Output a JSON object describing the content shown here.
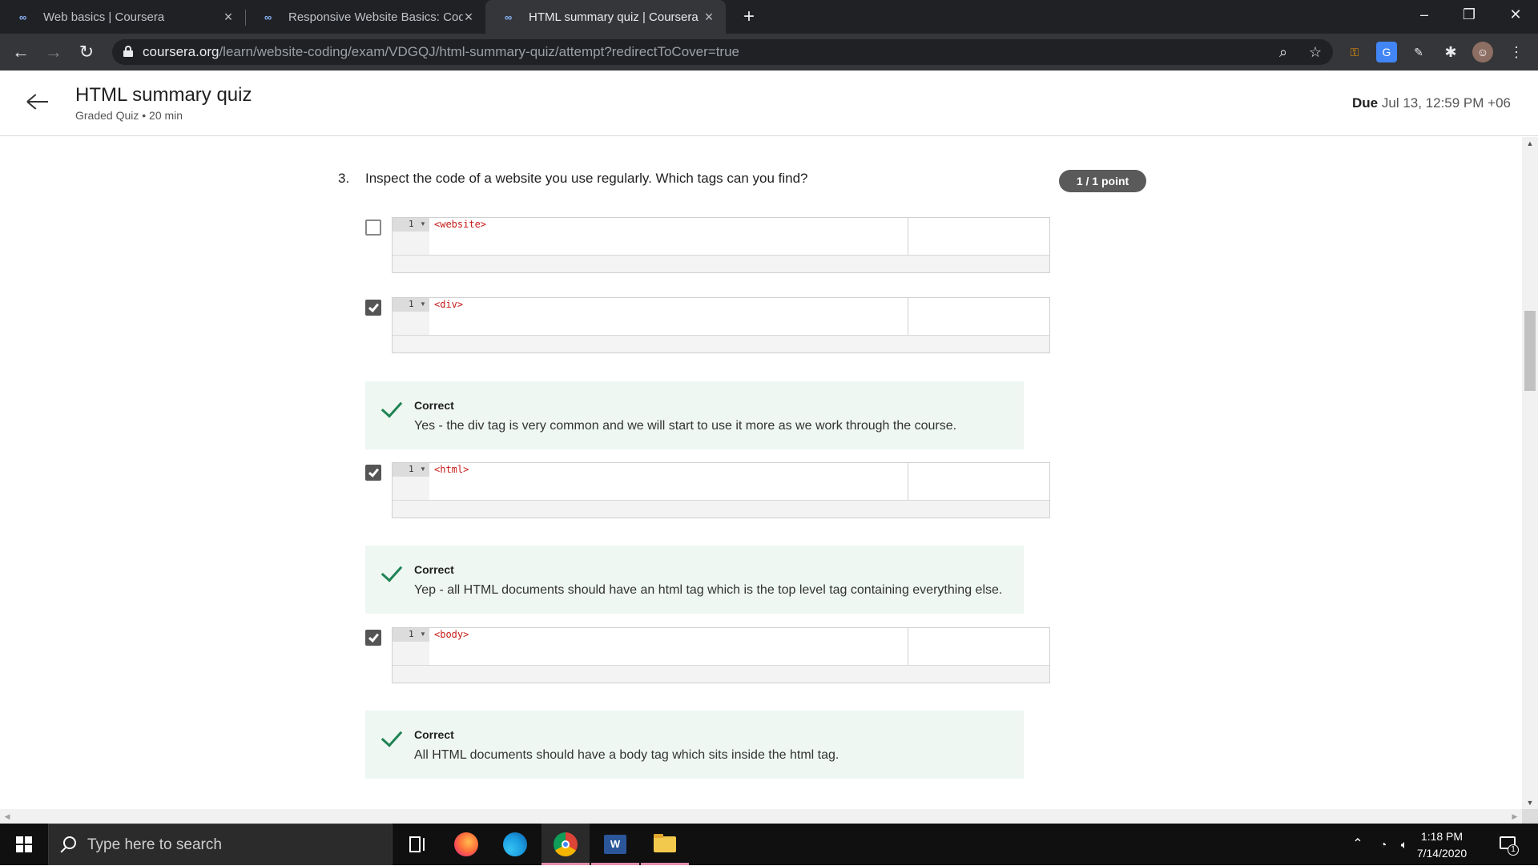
{
  "browser": {
    "tabs": [
      {
        "title": "Web basics | Coursera",
        "active": false
      },
      {
        "title": "Responsive Website Basics: Code",
        "active": false
      },
      {
        "title": "HTML summary quiz | Coursera",
        "active": true
      }
    ],
    "new_tab_symbol": "+",
    "url_host": "coursera.org",
    "url_path": "/learn/website-coding/exam/VDGQJ/html-summary-quiz/attempt?redirectToCover=true"
  },
  "header": {
    "title": "HTML summary quiz",
    "subtitle": "Graded Quiz • 20 min",
    "due_label": "Due",
    "due_value": "Jul 13, 12:59 PM +06"
  },
  "question": {
    "number": "3.",
    "text": "Inspect the code of a website you use regularly. Which tags can you find?",
    "points": "1 / 1 point",
    "options": [
      {
        "line": "1",
        "code": "<website>",
        "checked": false
      },
      {
        "line": "1",
        "code": "<div>",
        "checked": true
      },
      {
        "line": "1",
        "code": "<html>",
        "checked": true
      },
      {
        "line": "1",
        "code": "<body>",
        "checked": true
      }
    ],
    "feedback": [
      {
        "label": "Correct",
        "text": "Yes - the div tag is very common and we will start to use it more as we work through the course."
      },
      {
        "label": "Correct",
        "text": "Yep - all HTML documents should have an html tag which is the top level tag containing everything else."
      },
      {
        "label": "Correct",
        "text": "All HTML documents should have a body tag which sits inside the html tag."
      }
    ]
  },
  "taskbar": {
    "search_placeholder": "Type here to search",
    "time": "1:18 PM",
    "date": "7/14/2020",
    "notification_count": "1"
  },
  "colors": {
    "correct_green": "#1f8354",
    "feedback_bg": "#eef7f2",
    "points_badge": "#5a5a5a",
    "code_tag": "#c41a16"
  },
  "icons": [
    "coursera-icon",
    "close-icon",
    "back-icon",
    "forward-icon",
    "reload-icon",
    "lock-icon",
    "zoom-icon",
    "star-icon",
    "windows-start-icon",
    "search-icon",
    "task-view-icon",
    "firefox-icon",
    "edge-icon",
    "chrome-icon",
    "word-icon",
    "file-explorer-icon",
    "checkmark-icon"
  ]
}
